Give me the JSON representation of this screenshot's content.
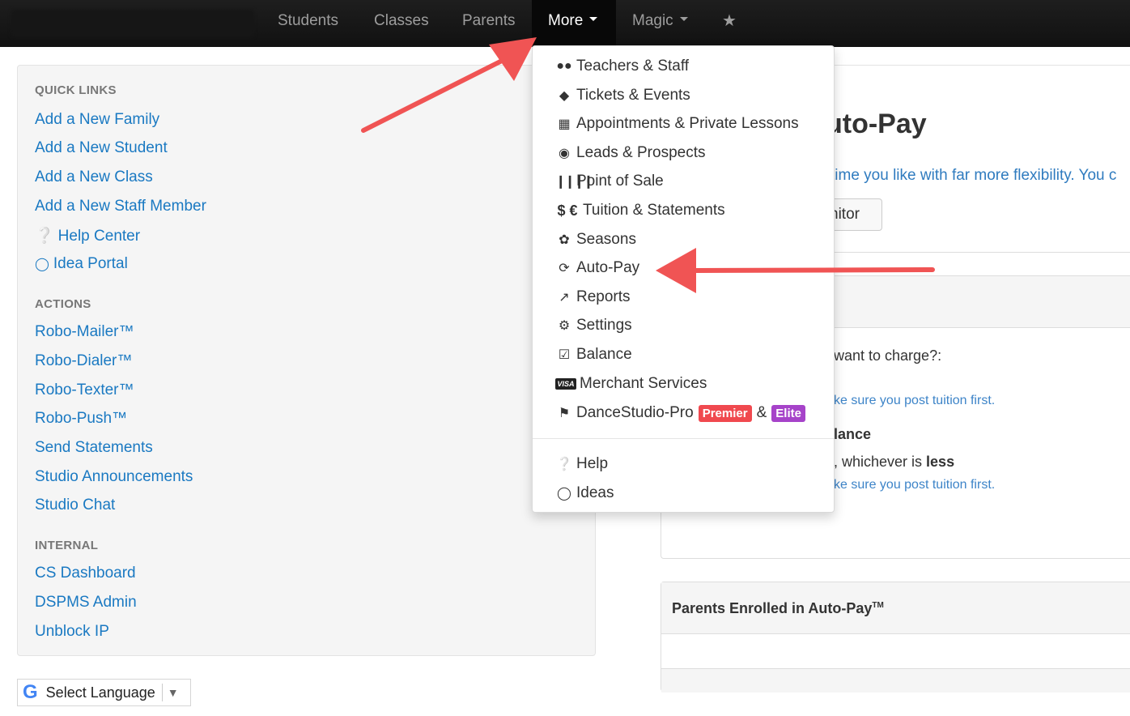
{
  "navbar": {
    "items": [
      {
        "label": "Students"
      },
      {
        "label": "Classes"
      },
      {
        "label": "Parents"
      },
      {
        "label": "More"
      },
      {
        "label": "Magic"
      }
    ],
    "star_icon": "star-icon"
  },
  "left_panel": {
    "quick_links_heading": "QUICK LINKS",
    "quick_links": [
      {
        "label": "Add a New Family"
      },
      {
        "label": "Add a New Student"
      },
      {
        "label": "Add a New Class"
      },
      {
        "label": "Add a New Staff Member"
      },
      {
        "label": "Help Center",
        "icon": "question-circle-icon"
      },
      {
        "label": "Idea Portal",
        "icon": "lightbulb-icon"
      }
    ],
    "actions_heading": "ACTIONS",
    "actions": [
      {
        "label": "Robo-Mailer™"
      },
      {
        "label": "Robo-Dialer™"
      },
      {
        "label": "Robo-Texter™"
      },
      {
        "label": "Robo-Push™"
      },
      {
        "label": "Send Statements"
      },
      {
        "label": "Studio Announcements"
      },
      {
        "label": "Studio Chat"
      }
    ],
    "internal_heading": "INTERNAL",
    "internal": [
      {
        "label": "CS Dashboard"
      },
      {
        "label": "DSPMS Admin"
      },
      {
        "label": "Unblock IP"
      }
    ]
  },
  "language": {
    "label": "Select Language",
    "logo": "G"
  },
  "main": {
    "title_partial": "uto-Pay",
    "intro_partial": "time you like with far more flexibility. You c",
    "button_partial": "nitor",
    "question_partial": "want to charge?:",
    "note1_partial": "ke sure you post tuition first.",
    "balance_partial": "lance",
    "whichever_prefix": ", whichever is ",
    "whichever_bold": "less",
    "note2_partial": "ke sure you post tuition first.",
    "enrolled_heading": "Parents Enrolled in Auto-Pay",
    "enrolled_tm": "TM"
  },
  "dropdown": {
    "items": [
      {
        "label": "Teachers & Staff",
        "icon": "users-icon"
      },
      {
        "label": "Tickets & Events",
        "icon": "ticket-icon"
      },
      {
        "label": "Appointments & Private Lessons",
        "icon": "calendar-icon"
      },
      {
        "label": "Leads & Prospects",
        "icon": "map-marker-icon"
      },
      {
        "label": "Point of Sale",
        "icon": "barcode-icon"
      },
      {
        "label": "Tuition & Statements",
        "icon": "dollar-euro-icon"
      },
      {
        "label": "Seasons",
        "icon": "leaf-icon"
      },
      {
        "label": "Auto-Pay",
        "icon": "refresh-icon"
      },
      {
        "label": "Reports",
        "icon": "line-chart-icon"
      },
      {
        "label": "Settings",
        "icon": "gears-icon"
      },
      {
        "label": "Balance",
        "icon": "check-square-icon"
      },
      {
        "label": "Merchant Services",
        "icon": "visa-icon"
      },
      {
        "label": "DanceStudio-Pro",
        "icon": "flag-icon"
      }
    ],
    "premier_badge": "Premier",
    "amp": "&",
    "elite_badge": "Elite",
    "help_label": "Help",
    "ideas_label": "Ideas"
  },
  "colors": {
    "navbar": "#151515",
    "link": "#1a79c2",
    "arrow": "#f05454",
    "premier": "#f0494f",
    "elite": "#a643c9"
  }
}
